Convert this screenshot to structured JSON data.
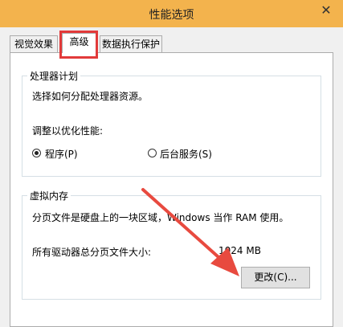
{
  "window": {
    "title": "性能选项",
    "close_glyph": "✕"
  },
  "tabs": [
    {
      "label": "视觉效果",
      "active": false
    },
    {
      "label": "高级",
      "active": true
    },
    {
      "label": "数据执行保护",
      "active": false
    }
  ],
  "processor": {
    "legend": "处理器计划",
    "description": "选择如何分配处理器资源。",
    "adjust_label": "调整以优化性能:",
    "options": [
      {
        "label": "程序(P)",
        "checked": true
      },
      {
        "label": "后台服务(S)",
        "checked": false
      }
    ]
  },
  "virtual_memory": {
    "legend": "虚拟内存",
    "description": "分页文件是硬盘上的一块区域，Windows 当作 RAM 使用。",
    "total_label": "所有驱动器总分页文件大小:",
    "total_value": "1024 MB",
    "change_button": "更改(C)..."
  },
  "colors": {
    "titlebar": "#f3b34d",
    "highlight": "#e23a3a",
    "arrow": "#e84a3f"
  }
}
